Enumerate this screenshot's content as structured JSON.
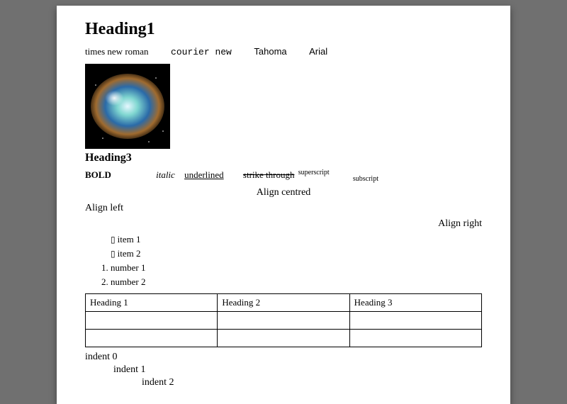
{
  "heading1": "Heading1",
  "fonts": {
    "times": "times new roman",
    "courier": "courier new",
    "tahoma": "Tahoma",
    "arial": "Arial"
  },
  "image_alt": "nebula-image",
  "heading3": "Heading3",
  "styles": {
    "bold": "BOLD",
    "italic": "italic",
    "underlined": "underlined",
    "strike": "strike through",
    "superscript": "superscript",
    "subscript": "subscript"
  },
  "align": {
    "center": "Align centred",
    "left": "Align left",
    "right": "Align right"
  },
  "bullets": [
    "item 1",
    "item 2"
  ],
  "numbers": [
    "number 1",
    "number 2"
  ],
  "table": {
    "headers": [
      "Heading 1",
      "Heading 2",
      "Heading 3"
    ]
  },
  "indents": {
    "i0": "indent 0",
    "i1": "indent 1",
    "i2": "indent 2"
  }
}
